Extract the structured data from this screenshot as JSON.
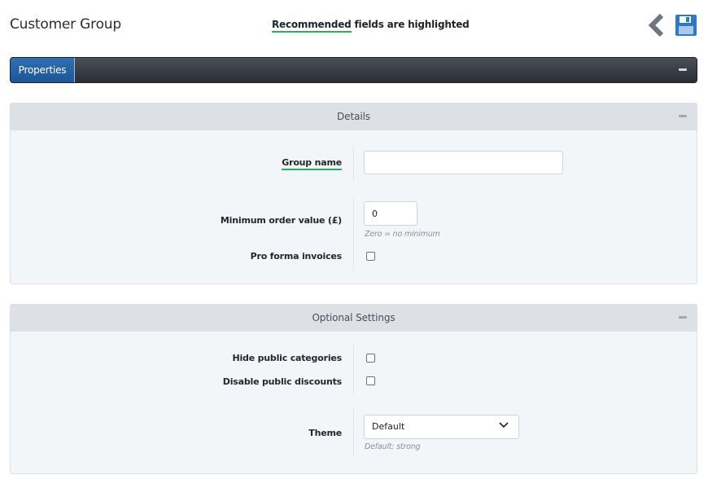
{
  "header": {
    "title": "Customer Group",
    "note_highlight": "Recommended",
    "note_rest": " fields are highlighted",
    "back_icon": "chevron-left-icon",
    "save_icon": "floppy-disk-icon"
  },
  "tabs": [
    {
      "label": "Properties",
      "active": true
    }
  ],
  "colors": {
    "accent": "#1d5699",
    "recommended_underline": "#22b35f",
    "tabbar": "#2a2e34"
  },
  "details": {
    "title": "Details",
    "fields": {
      "group_name": {
        "label": "Group name",
        "value": "",
        "recommended": true
      },
      "min_order": {
        "label": "Minimum order value (£)",
        "value": "0",
        "hint": "Zero = no minimum"
      },
      "pro_forma": {
        "label": "Pro forma invoices",
        "checked": false
      }
    }
  },
  "optional": {
    "title": "Optional Settings",
    "fields": {
      "hide_categories": {
        "label": "Hide public categories",
        "checked": false
      },
      "disable_discounts": {
        "label": "Disable public discounts",
        "checked": false
      },
      "theme": {
        "label": "Theme",
        "value": "Default",
        "hint": "Default: strong"
      }
    }
  }
}
